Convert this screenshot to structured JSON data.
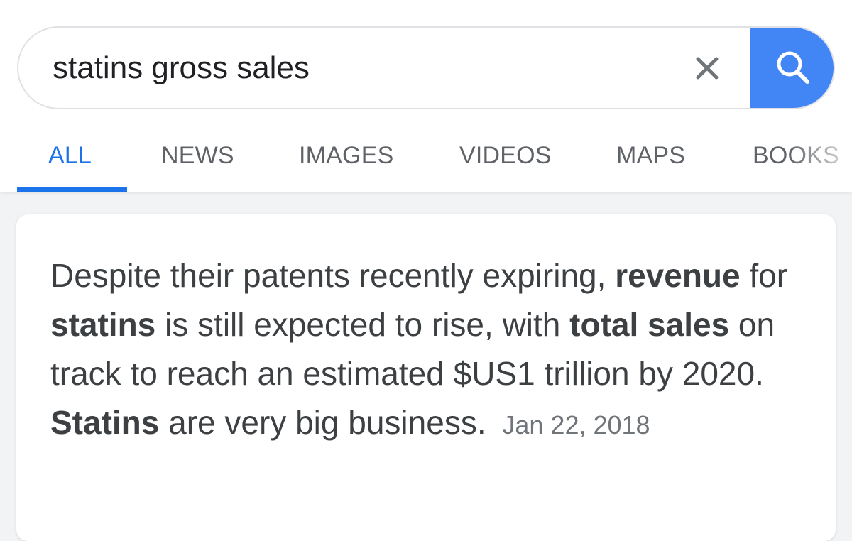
{
  "search": {
    "query": "statins gross sales"
  },
  "icons": {
    "clear": "close-icon",
    "search": "search-icon"
  },
  "colors": {
    "accent": "#1a73e8",
    "search_button": "#4285f4",
    "tab_text": "#5f6368",
    "snippet_text": "#3c4043"
  },
  "tabs": [
    {
      "label": "ALL",
      "active": true
    },
    {
      "label": "NEWS",
      "active": false
    },
    {
      "label": "IMAGES",
      "active": false
    },
    {
      "label": "VIDEOS",
      "active": false
    },
    {
      "label": "MAPS",
      "active": false
    },
    {
      "label": "BOOKS",
      "active": false
    }
  ],
  "featured_snippet": {
    "parts": [
      {
        "text": "Despite their patents recently expiring, ",
        "bold": false
      },
      {
        "text": "revenue",
        "bold": true
      },
      {
        "text": " for ",
        "bold": false
      },
      {
        "text": "statins",
        "bold": true
      },
      {
        "text": " is still expected to rise, with ",
        "bold": false
      },
      {
        "text": "total sales",
        "bold": true
      },
      {
        "text": " on track to reach an estimated $US1 trillion by 2020. ",
        "bold": false
      },
      {
        "text": "Statins",
        "bold": true
      },
      {
        "text": " are very big business.",
        "bold": false
      }
    ],
    "date": "Jan 22, 2018"
  }
}
